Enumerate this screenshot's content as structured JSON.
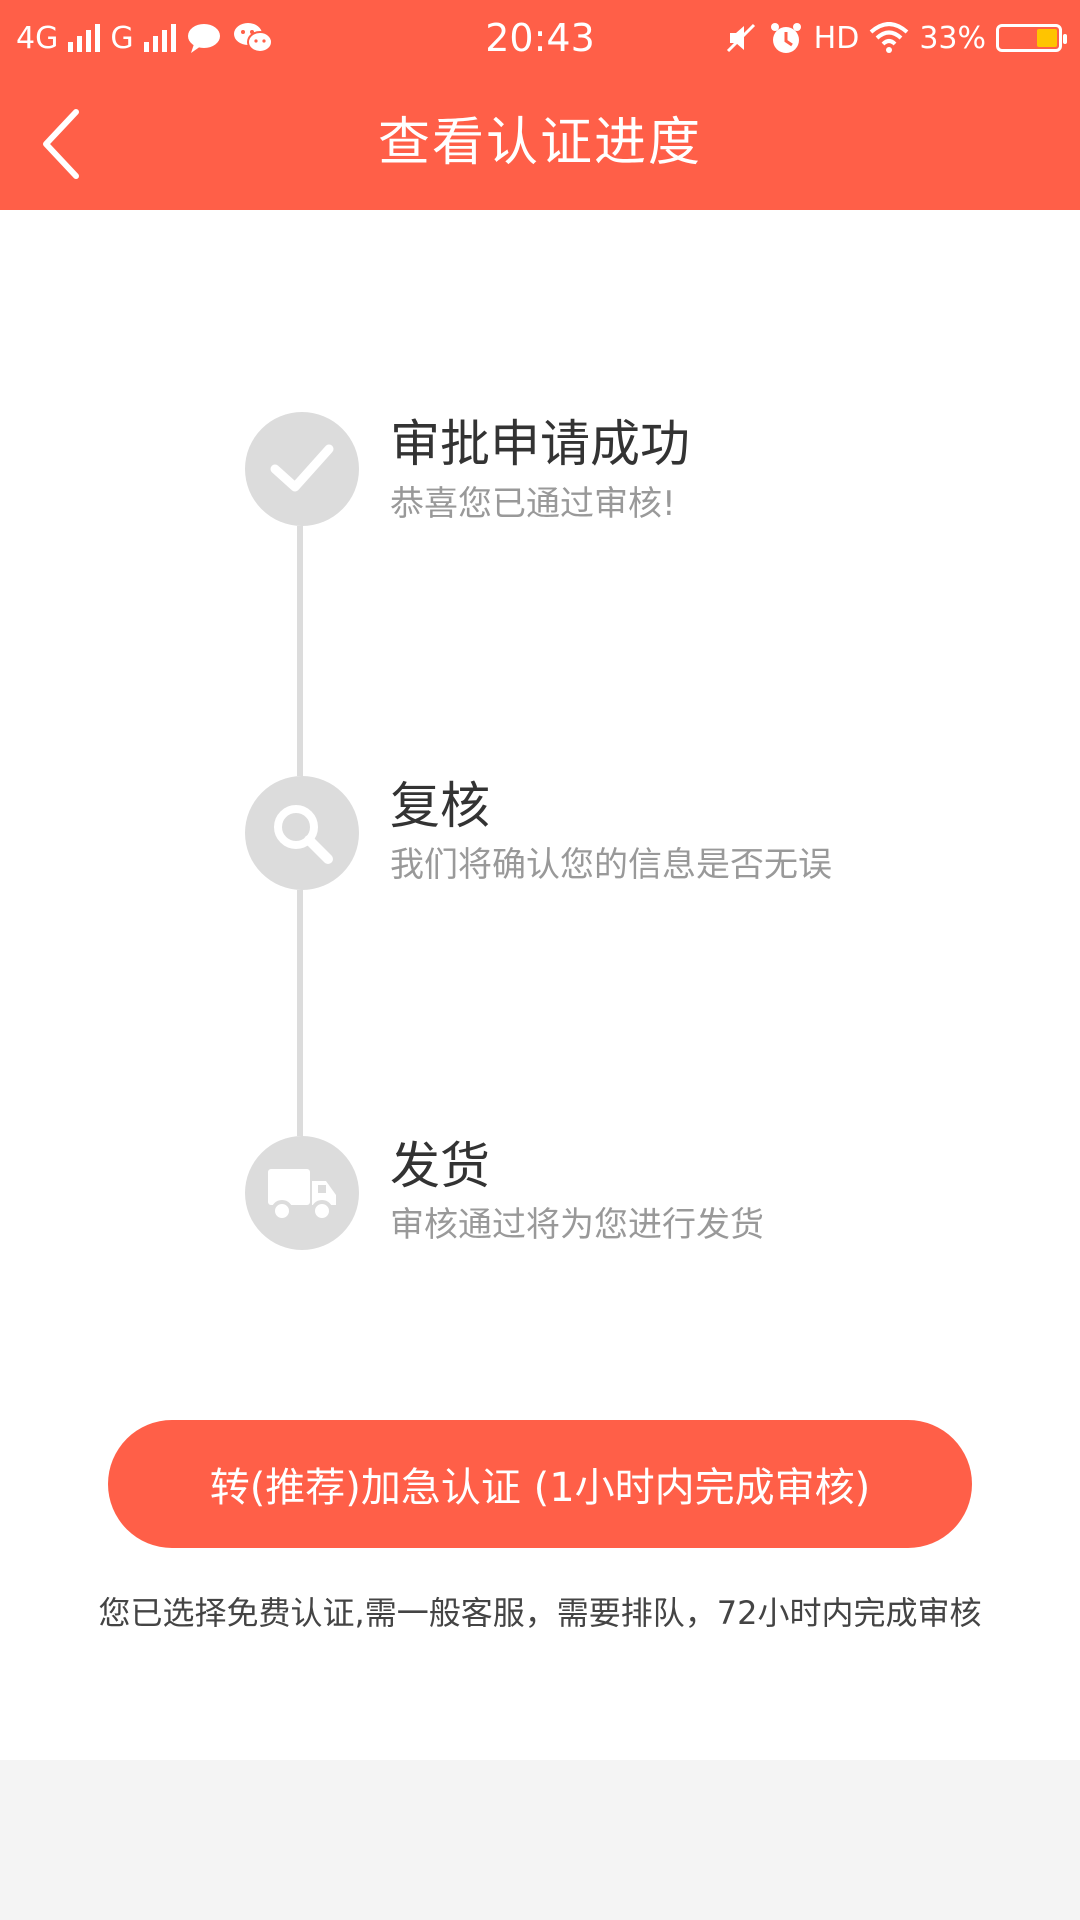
{
  "status_bar": {
    "network1": "4G",
    "network2": "G",
    "time": "20:43",
    "hd": "HD",
    "battery": "33%",
    "battery_level": 0.33,
    "battery_color": "#ffc400",
    "icons": [
      "signal-icon",
      "chat-bubble-icon",
      "wechat-icon",
      "mute-icon",
      "alarm-icon",
      "wifi-icon",
      "battery-icon"
    ]
  },
  "header": {
    "title": "查看认证进度",
    "back_icon": "chevron-left-icon",
    "background": "#ff5f48"
  },
  "steps": [
    {
      "title": "审批申请成功",
      "desc": "恭喜您已通过审核!",
      "icon": "check-icon"
    },
    {
      "title": "复核",
      "desc": "我们将确认您的信息是否无误",
      "icon": "search-icon"
    },
    {
      "title": "发货",
      "desc": "审核通过将为您进行发货",
      "icon": "truck-icon"
    }
  ],
  "cta": {
    "label": "转(推荐)加急认证 (1小时内完成审核)"
  },
  "note": "您已选择免费认证,需一般客服，需要排队，72小时内完成审核"
}
